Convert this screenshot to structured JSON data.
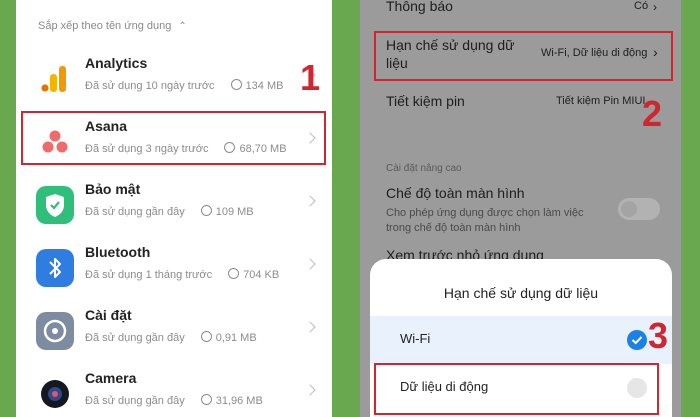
{
  "left": {
    "sort_label": "Sắp xếp theo tên ứng dụng",
    "apps": [
      {
        "name": "Analytics",
        "used": "Đã sử dụng 10 ngày trước",
        "size": "134 MB"
      },
      {
        "name": "Asana",
        "used": "Đã sử dụng 3 ngày trước",
        "size": "68,70 MB"
      },
      {
        "name": "Bảo mật",
        "used": "Đã sử dụng gần đây",
        "size": "109 MB"
      },
      {
        "name": "Bluetooth",
        "used": "Đã sử dụng 1 tháng trước",
        "size": "704 KB"
      },
      {
        "name": "Cài đặt",
        "used": "Đã sử dụng gần đây",
        "size": "0,91 MB"
      },
      {
        "name": "Camera",
        "used": "Đã sử dụng gần đây",
        "size": "31,96 MB"
      }
    ]
  },
  "right": {
    "notifications": {
      "label": "Thông báo",
      "value": "Có"
    },
    "data_limit": {
      "label": "Hạn chế sử dụng dữ liệu",
      "value": "Wi-Fi, Dữ liệu di động"
    },
    "battery": {
      "label": "Tiết kiệm pin",
      "value": "Tiết kiệm Pin MIUI"
    },
    "advanced_header": "Cài đặt nâng cao",
    "fullscreen": {
      "label": "Chế độ toàn màn hình",
      "desc": "Cho phép ứng dụng được chọn làm việc trong chế độ toàn màn hình"
    },
    "preview_label": "Xem trước nhỏ ứng dụng",
    "sheet": {
      "title": "Hạn chế sử dụng dữ liệu",
      "options": [
        {
          "label": "Wi-Fi",
          "checked": true
        },
        {
          "label": "Dữ liệu di động",
          "checked": false
        }
      ]
    }
  },
  "steps": [
    "1",
    "2",
    "3"
  ],
  "colors": {
    "highlight": "#d0262f",
    "accent": "#1d80e5",
    "background": "#6aa84f"
  }
}
